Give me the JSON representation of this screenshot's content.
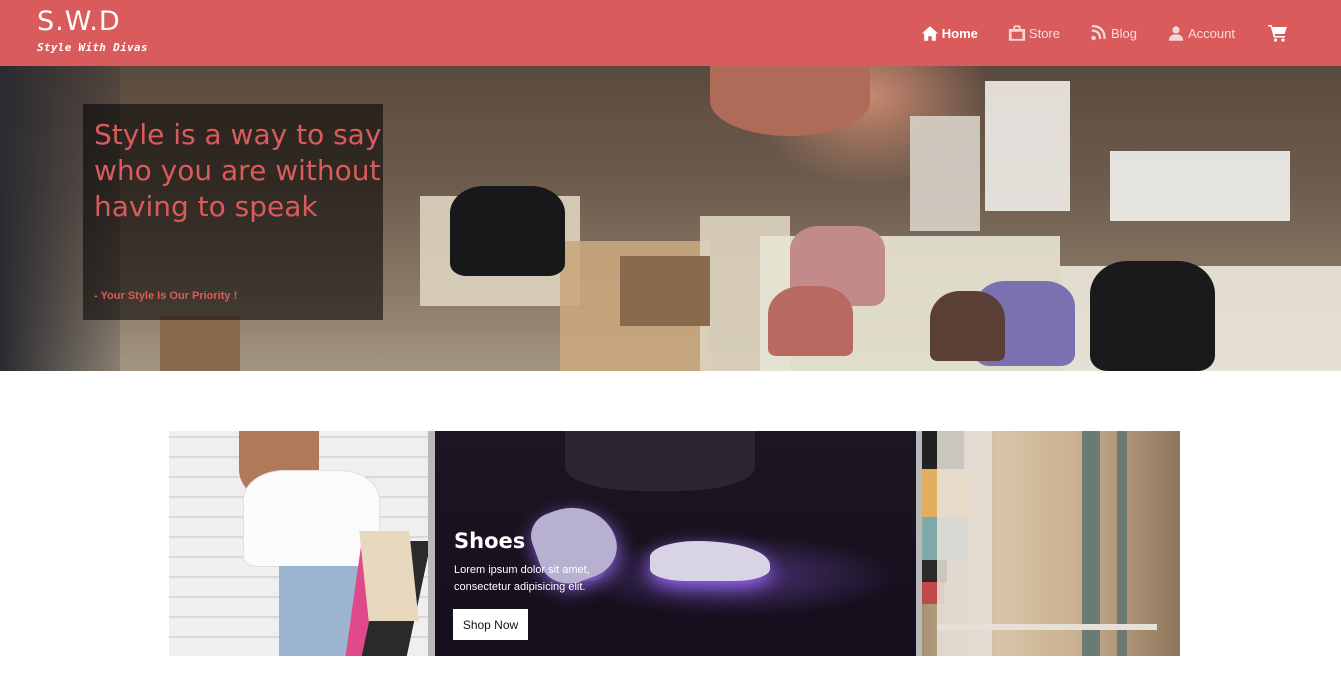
{
  "brand": {
    "title": "S.W.D",
    "tagline": "Style With Divas"
  },
  "nav": {
    "items": [
      {
        "label": "Home",
        "icon": "home-icon",
        "active": true
      },
      {
        "label": "Store",
        "icon": "store-icon",
        "active": false
      },
      {
        "label": "Blog",
        "icon": "rss-icon",
        "active": false
      },
      {
        "label": "Account",
        "icon": "user-icon",
        "active": false
      }
    ],
    "cart_icon": "cart-icon"
  },
  "hero": {
    "headline": "Style is a way to say who you are without having to speak",
    "subline": "- Your Style Is Our Priority !"
  },
  "featured": {
    "title": "Shoes",
    "text": "Lorem ipsum dolor sit amet, consectetur adipisicing elit.",
    "button": "Shop Now"
  },
  "colors": {
    "brand": "#d95b5b",
    "white": "#ffffff"
  }
}
